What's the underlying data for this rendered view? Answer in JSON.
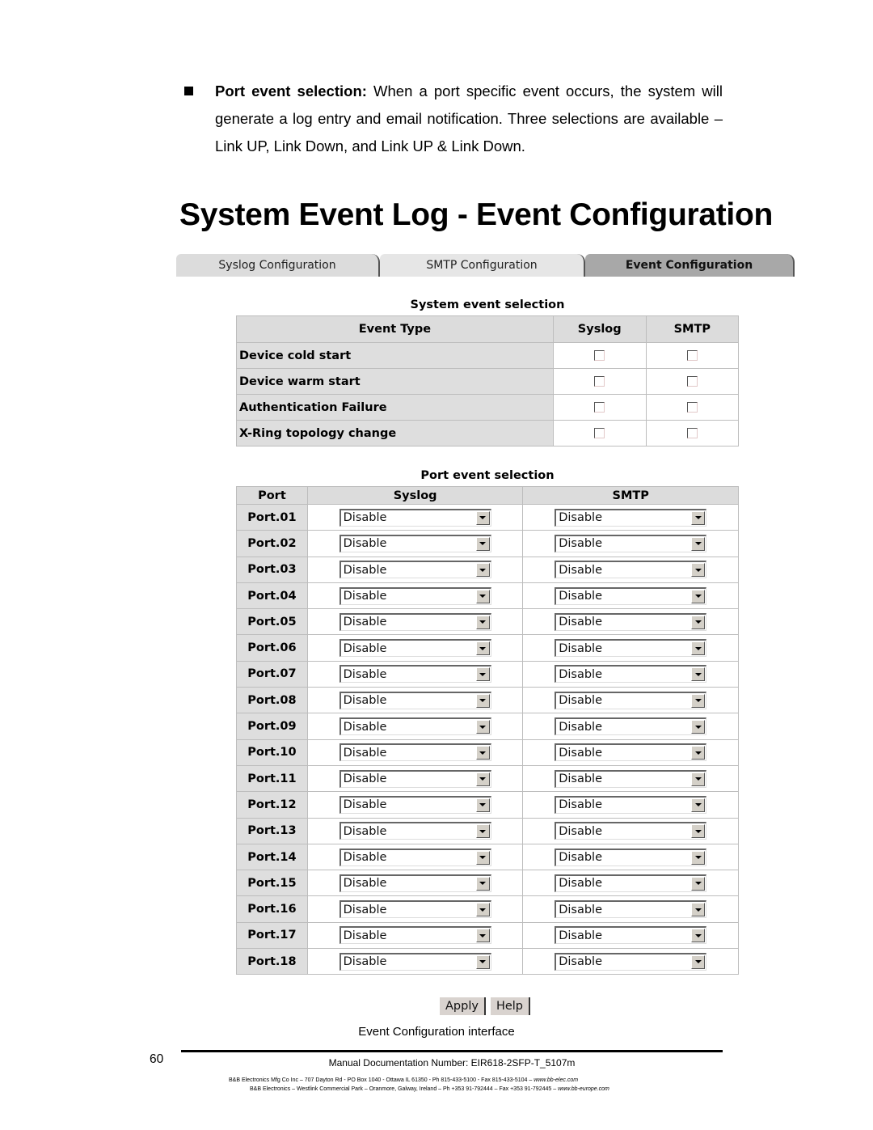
{
  "intro": {
    "term": "Port event selection:",
    "body": " When a port specific event occurs, the system will generate a log entry and email notification. Three selections are available – Link UP, Link Down, and Link UP & Link Down."
  },
  "page_title": "System Event Log - Event Configuration",
  "tabs": [
    {
      "label": "Syslog Configuration",
      "active": false
    },
    {
      "label": "SMTP Configuration",
      "active": false
    },
    {
      "label": "Event Configuration",
      "active": true
    }
  ],
  "system_events": {
    "caption": "System event selection",
    "headers": [
      "Event Type",
      "Syslog",
      "SMTP"
    ],
    "rows": [
      {
        "label": "Device cold start",
        "syslog": false,
        "smtp": false
      },
      {
        "label": "Device warm start",
        "syslog": false,
        "smtp": false
      },
      {
        "label": "Authentication Failure",
        "syslog": false,
        "smtp": false
      },
      {
        "label": "X-Ring topology change",
        "syslog": false,
        "smtp": false
      }
    ]
  },
  "port_events": {
    "caption": "Port event selection",
    "headers": [
      "Port",
      "Syslog",
      "SMTP"
    ],
    "rows": [
      {
        "port": "Port.01",
        "syslog": "Disable",
        "smtp": "Disable"
      },
      {
        "port": "Port.02",
        "syslog": "Disable",
        "smtp": "Disable"
      },
      {
        "port": "Port.03",
        "syslog": "Disable",
        "smtp": "Disable"
      },
      {
        "port": "Port.04",
        "syslog": "Disable",
        "smtp": "Disable"
      },
      {
        "port": "Port.05",
        "syslog": "Disable",
        "smtp": "Disable"
      },
      {
        "port": "Port.06",
        "syslog": "Disable",
        "smtp": "Disable"
      },
      {
        "port": "Port.07",
        "syslog": "Disable",
        "smtp": "Disable"
      },
      {
        "port": "Port.08",
        "syslog": "Disable",
        "smtp": "Disable"
      },
      {
        "port": "Port.09",
        "syslog": "Disable",
        "smtp": "Disable"
      },
      {
        "port": "Port.10",
        "syslog": "Disable",
        "smtp": "Disable"
      },
      {
        "port": "Port.11",
        "syslog": "Disable",
        "smtp": "Disable"
      },
      {
        "port": "Port.12",
        "syslog": "Disable",
        "smtp": "Disable"
      },
      {
        "port": "Port.13",
        "syslog": "Disable",
        "smtp": "Disable"
      },
      {
        "port": "Port.14",
        "syslog": "Disable",
        "smtp": "Disable"
      },
      {
        "port": "Port.15",
        "syslog": "Disable",
        "smtp": "Disable"
      },
      {
        "port": "Port.16",
        "syslog": "Disable",
        "smtp": "Disable"
      },
      {
        "port": "Port.17",
        "syslog": "Disable",
        "smtp": "Disable"
      },
      {
        "port": "Port.18",
        "syslog": "Disable",
        "smtp": "Disable"
      }
    ]
  },
  "buttons": {
    "apply": "Apply",
    "help": "Help"
  },
  "figure_caption": "Event Configuration interface",
  "footer": {
    "page_number": "60",
    "doc_number": "Manual Documentation Number: EIR618-2SFP-T_5107m",
    "address_us": "B&B Electronics Mfg Co Inc – 707 Dayton Rd - PO Box 1040 - Ottawa IL 61350 - Ph 815-433-5100 - Fax 815-433-5104 – ",
    "url_us": "www.bb-elec.com",
    "address_eu": "B&B Electronics – Westlink Commercial Park – Oranmore, Galway, Ireland – Ph +353 91-792444 – Fax +353 91-792445 – ",
    "url_eu": "www.bb-europe.com"
  }
}
